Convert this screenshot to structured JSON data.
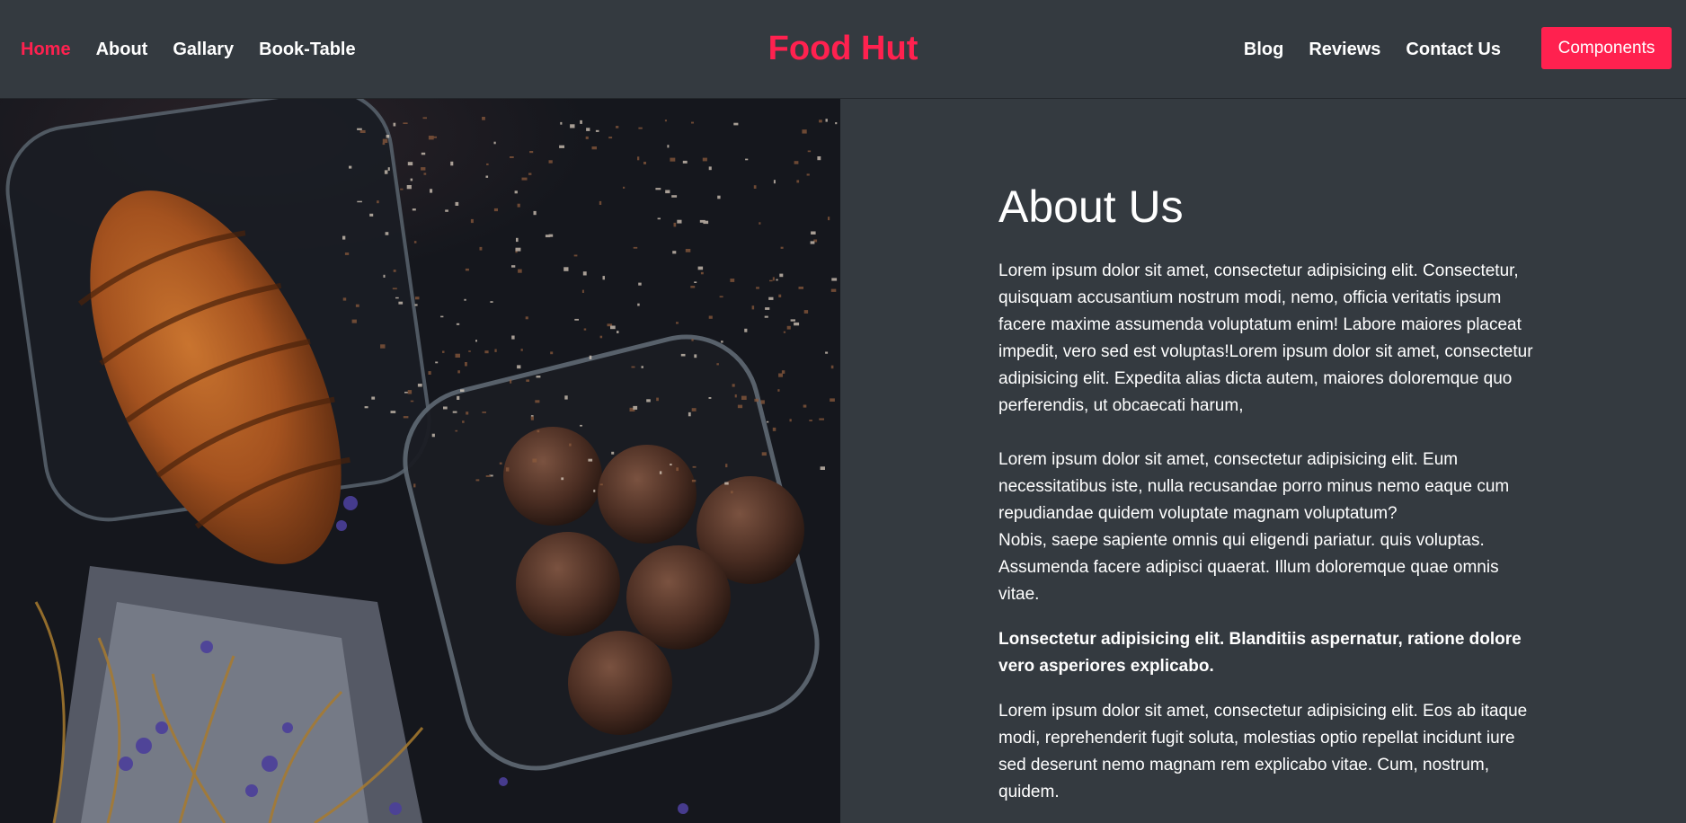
{
  "nav": {
    "left": [
      "Home",
      "About",
      "Gallary",
      "Book-Table"
    ],
    "right": [
      "Blog",
      "Reviews",
      "Contact Us"
    ],
    "brand": "Food Hut",
    "button": "Components",
    "active_item": "Home"
  },
  "about": {
    "title": "About Us",
    "paragraph1_line1": "Lorem ipsum dolor sit amet, consectetur adipisicing elit. Consectetur, quisquam accusantium nostrum modi, nemo, officia veritatis ipsum facere maxime assumenda voluptatum enim! Labore maiores placeat impedit, vero sed est voluptas!Lorem ipsum dolor sit amet, consectetur adipisicing elit. Expedita alias dicta autem, maiores doloremque quo perferendis, ut obcaecati harum,",
    "paragraph2_line1": "Lorem ipsum dolor sit amet, consectetur adipisicing elit. Eum necessitatibus iste, nulla recusandae porro minus nemo eaque cum repudiandae quidem voluptate magnam voluptatum?",
    "paragraph2_line2": "Nobis, saepe sapiente omnis qui eligendi pariatur. quis voluptas. Assumenda facere adipisci quaerat. Illum doloremque quae omnis vitae.",
    "bold_paragraph": "Lonsectetur adipisicing elit. Blanditiis aspernatur, ratione dolore vero asperiores explicabo.",
    "paragraph4": "Lorem ipsum dolor sit amet, consectetur adipisicing elit. Eos ab itaque modi, reprehenderit fugit soluta, molestias optio repellat incidunt iure sed deserunt nemo magnam rem explicabo vitae. Cum, nostrum, quidem."
  },
  "colors": {
    "background": "#343a40",
    "accent": "#ff214f",
    "text": "#ffffff"
  }
}
